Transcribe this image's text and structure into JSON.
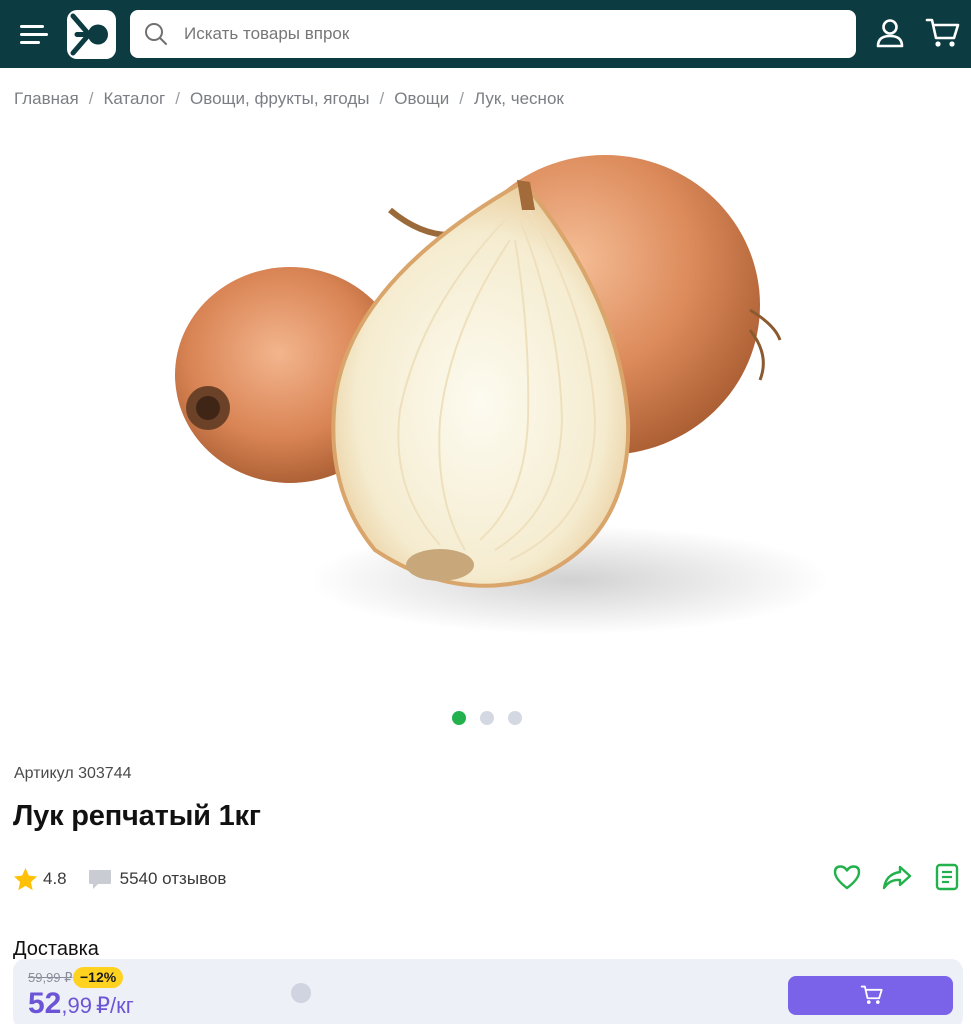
{
  "header": {
    "search_placeholder": "Искать товары впрок",
    "colors": {
      "background": "#0c3c41"
    }
  },
  "breadcrumb": [
    "Главная",
    "Каталог",
    "Овощи, фрукты, ягоды",
    "Овощи",
    "Лук, чеснок"
  ],
  "gallery": {
    "slides": 3,
    "active_index": 0
  },
  "product": {
    "article": "Артикул 303744",
    "title": "Лук репчатый 1кг",
    "rating": "4.8",
    "reviews": "5540 отзывов"
  },
  "delivery_label": "Доставка",
  "price": {
    "old": "59,99 ₽",
    "discount": "−12%",
    "whole": "52",
    "fraction": ",99",
    "unit": "₽/кг"
  },
  "colors": {
    "accent_green": "#22b14c",
    "price_purple": "#6b55d6",
    "button_purple": "#7a63e8",
    "badge_yellow": "#ffd21f"
  }
}
